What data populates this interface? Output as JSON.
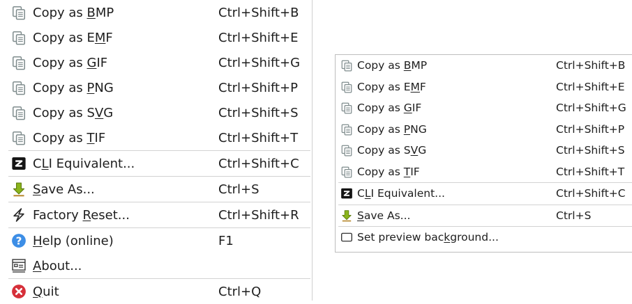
{
  "menu_left": [
    {
      "type": "item",
      "icon": "copy-icon",
      "pre": "Copy as ",
      "ul": "B",
      "post": "MP",
      "shortcut": "Ctrl+Shift+B"
    },
    {
      "type": "item",
      "icon": "copy-icon",
      "pre": "Copy as E",
      "ul": "M",
      "post": "F",
      "shortcut": "Ctrl+Shift+E"
    },
    {
      "type": "item",
      "icon": "copy-icon",
      "pre": "Copy as ",
      "ul": "G",
      "post": "IF",
      "shortcut": "Ctrl+Shift+G"
    },
    {
      "type": "item",
      "icon": "copy-icon",
      "pre": "Copy as ",
      "ul": "P",
      "post": "NG",
      "shortcut": "Ctrl+Shift+P"
    },
    {
      "type": "item",
      "icon": "copy-icon",
      "pre": "Copy as S",
      "ul": "V",
      "post": "G",
      "shortcut": "Ctrl+Shift+S"
    },
    {
      "type": "item",
      "icon": "copy-icon",
      "pre": "Copy as ",
      "ul": "T",
      "post": "IF",
      "shortcut": "Ctrl+Shift+T"
    },
    {
      "type": "separator"
    },
    {
      "type": "item",
      "icon": "cli-icon",
      "pre": "C",
      "ul": "L",
      "post": "I Equivalent...",
      "shortcut": "Ctrl+Shift+C"
    },
    {
      "type": "separator"
    },
    {
      "type": "item",
      "icon": "save-icon",
      "pre": "",
      "ul": "S",
      "post": "ave As...",
      "shortcut": "Ctrl+S"
    },
    {
      "type": "separator"
    },
    {
      "type": "item",
      "icon": "reset-icon",
      "pre": "Factory ",
      "ul": "R",
      "post": "eset...",
      "shortcut": "Ctrl+Shift+R"
    },
    {
      "type": "separator"
    },
    {
      "type": "item",
      "icon": "help-icon",
      "pre": "",
      "ul": "H",
      "post": "elp (online)",
      "shortcut": "F1"
    },
    {
      "type": "item",
      "icon": "about-icon",
      "pre": "",
      "ul": "A",
      "post": "bout...",
      "shortcut": ""
    },
    {
      "type": "separator"
    },
    {
      "type": "item",
      "icon": "quit-icon",
      "pre": "",
      "ul": "Q",
      "post": "uit",
      "shortcut": "Ctrl+Q"
    }
  ],
  "menu_right": [
    {
      "type": "item",
      "icon": "copy-icon",
      "pre": "Copy as ",
      "ul": "B",
      "post": "MP",
      "shortcut": "Ctrl+Shift+B"
    },
    {
      "type": "item",
      "icon": "copy-icon",
      "pre": "Copy as E",
      "ul": "M",
      "post": "F",
      "shortcut": "Ctrl+Shift+E"
    },
    {
      "type": "item",
      "icon": "copy-icon",
      "pre": "Copy as ",
      "ul": "G",
      "post": "IF",
      "shortcut": "Ctrl+Shift+G"
    },
    {
      "type": "item",
      "icon": "copy-icon",
      "pre": "Copy as ",
      "ul": "P",
      "post": "NG",
      "shortcut": "Ctrl+Shift+P"
    },
    {
      "type": "item",
      "icon": "copy-icon",
      "pre": "Copy as S",
      "ul": "V",
      "post": "G",
      "shortcut": "Ctrl+Shift+S"
    },
    {
      "type": "item",
      "icon": "copy-icon",
      "pre": "Copy as ",
      "ul": "T",
      "post": "IF",
      "shortcut": "Ctrl+Shift+T"
    },
    {
      "type": "separator"
    },
    {
      "type": "item",
      "icon": "cli-icon",
      "pre": "C",
      "ul": "L",
      "post": "I Equivalent...",
      "shortcut": "Ctrl+Shift+C"
    },
    {
      "type": "separator"
    },
    {
      "type": "item",
      "icon": "save-icon",
      "pre": "",
      "ul": "S",
      "post": "ave As...",
      "shortcut": "Ctrl+S"
    },
    {
      "type": "separator"
    },
    {
      "type": "item",
      "icon": "preview-background-icon",
      "pre": "Set preview bac",
      "ul": "k",
      "post": "ground...",
      "shortcut": ""
    }
  ],
  "colors": {
    "help_blue": "#3d8ee6",
    "quit_red": "#d6303a",
    "save_green": "#8ab51c",
    "copy_gray": "#7f8c8d"
  }
}
